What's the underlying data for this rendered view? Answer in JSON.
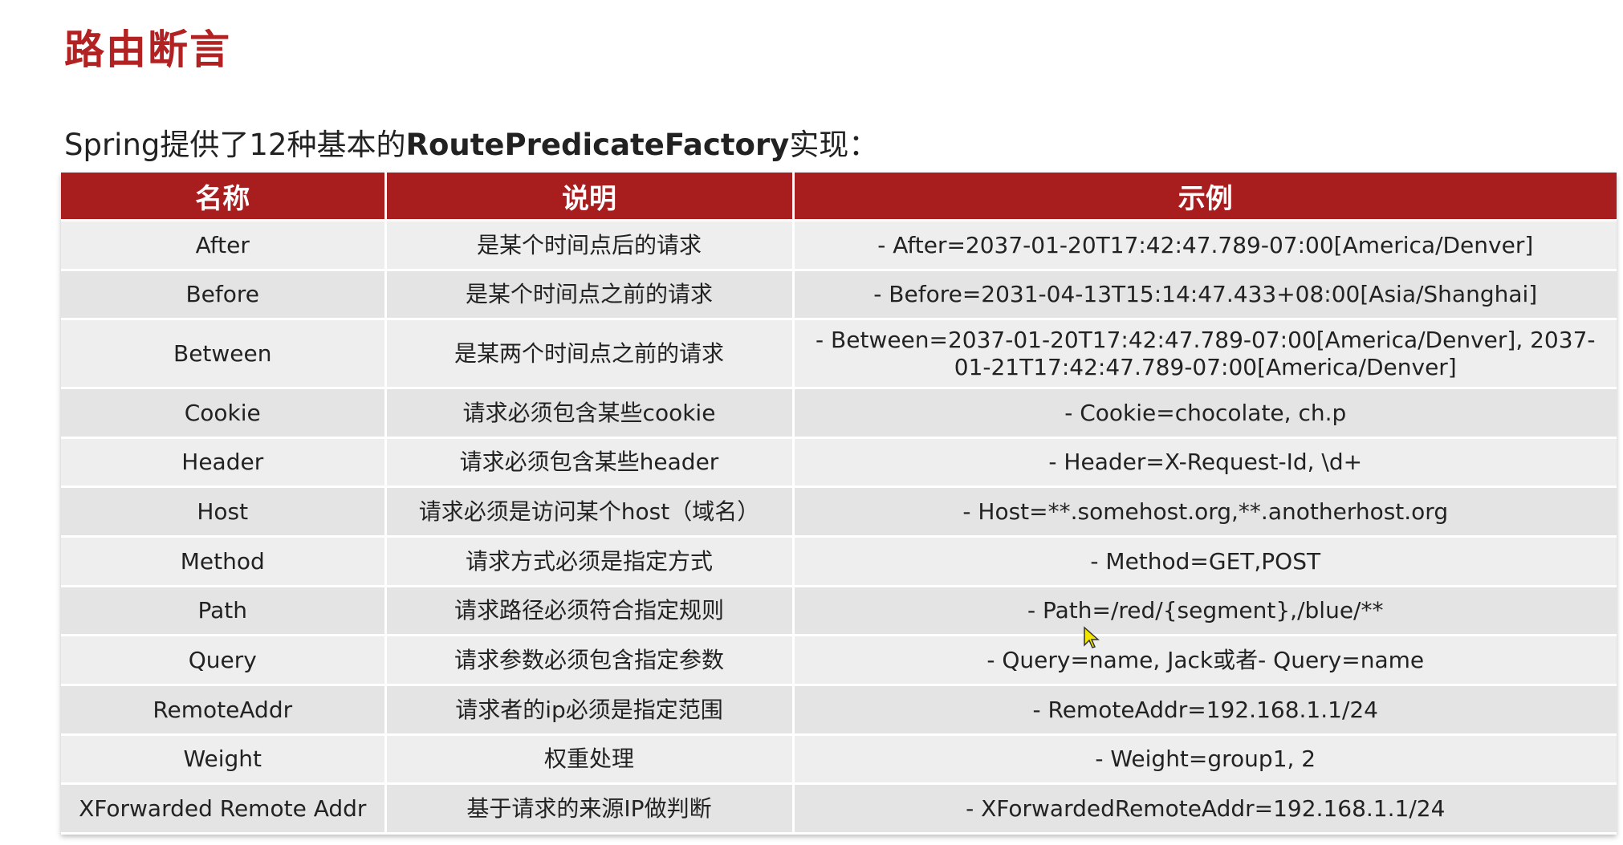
{
  "header": {
    "title": "路由断言",
    "subtitle_prefix": "Spring提供了12种基本的",
    "subtitle_bold": "RoutePredicateFactory",
    "subtitle_suffix": "实现："
  },
  "table": {
    "columns": [
      "名称",
      "说明",
      "示例"
    ],
    "rows": [
      {
        "name": "After",
        "desc": "是某个时间点后的请求",
        "example": "- After=2037-01-20T17:42:47.789-07:00[America/Denver]"
      },
      {
        "name": "Before",
        "desc": "是某个时间点之前的请求",
        "example": "- Before=2031-04-13T15:14:47.433+08:00[Asia/Shanghai]"
      },
      {
        "name": "Between",
        "desc": "是某两个时间点之前的请求",
        "example": "- Between=2037-01-20T17:42:47.789-07:00[America/Denver], 2037-01-21T17:42:47.789-07:00[America/Denver]"
      },
      {
        "name": "Cookie",
        "desc": "请求必须包含某些cookie",
        "example": "- Cookie=chocolate, ch.p"
      },
      {
        "name": "Header",
        "desc": "请求必须包含某些header",
        "example": "- Header=X-Request-Id, \\d+"
      },
      {
        "name": "Host",
        "desc": "请求必须是访问某个host（域名）",
        "example": "- Host=**.somehost.org,**.anotherhost.org"
      },
      {
        "name": "Method",
        "desc": "请求方式必须是指定方式",
        "example": "- Method=GET,POST"
      },
      {
        "name": "Path",
        "desc": "请求路径必须符合指定规则",
        "example": "- Path=/red/{segment},/blue/**"
      },
      {
        "name": "Query",
        "desc": "请求参数必须包含指定参数",
        "example": "- Query=name, Jack或者- Query=name"
      },
      {
        "name": "RemoteAddr",
        "desc": "请求者的ip必须是指定范围",
        "example": "- RemoteAddr=192.168.1.1/24"
      },
      {
        "name": "Weight",
        "desc": "权重处理",
        "example": "- Weight=group1, 2"
      },
      {
        "name": "XForwarded Remote Addr",
        "desc": "基于请求的来源IP做判断",
        "example": "- XForwardedRemoteAddr=192.168.1.1/24"
      }
    ]
  },
  "colors": {
    "title": "#b22222",
    "header_bg": "#a81e1e",
    "row_bg": "#eeeeee"
  }
}
